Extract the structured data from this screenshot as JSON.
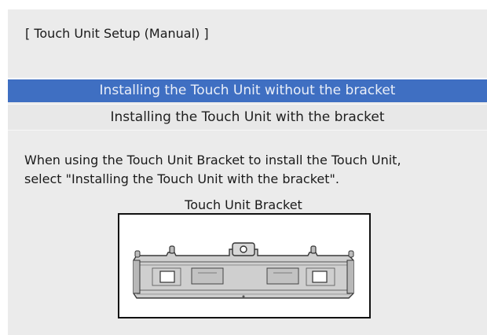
{
  "dialog": {
    "title": "[ Touch Unit Setup (Manual) ]"
  },
  "options": [
    {
      "label": "Installing the Touch Unit without the bracket",
      "selected": true
    },
    {
      "label": "Installing the Touch Unit with the bracket",
      "selected": false
    }
  ],
  "description": {
    "line1": "When using the Touch Unit Bracket to install the Touch Unit,",
    "line2": "select \"Installing the Touch Unit with the bracket\"."
  },
  "figure": {
    "caption": "Touch Unit Bracket",
    "image": "touch-unit-bracket-illustration"
  },
  "colors": {
    "screen_background": "#ebebeb",
    "selected_background": "#3f6fc2",
    "selected_text": "#e9eef8",
    "text": "#1a1a1a"
  }
}
